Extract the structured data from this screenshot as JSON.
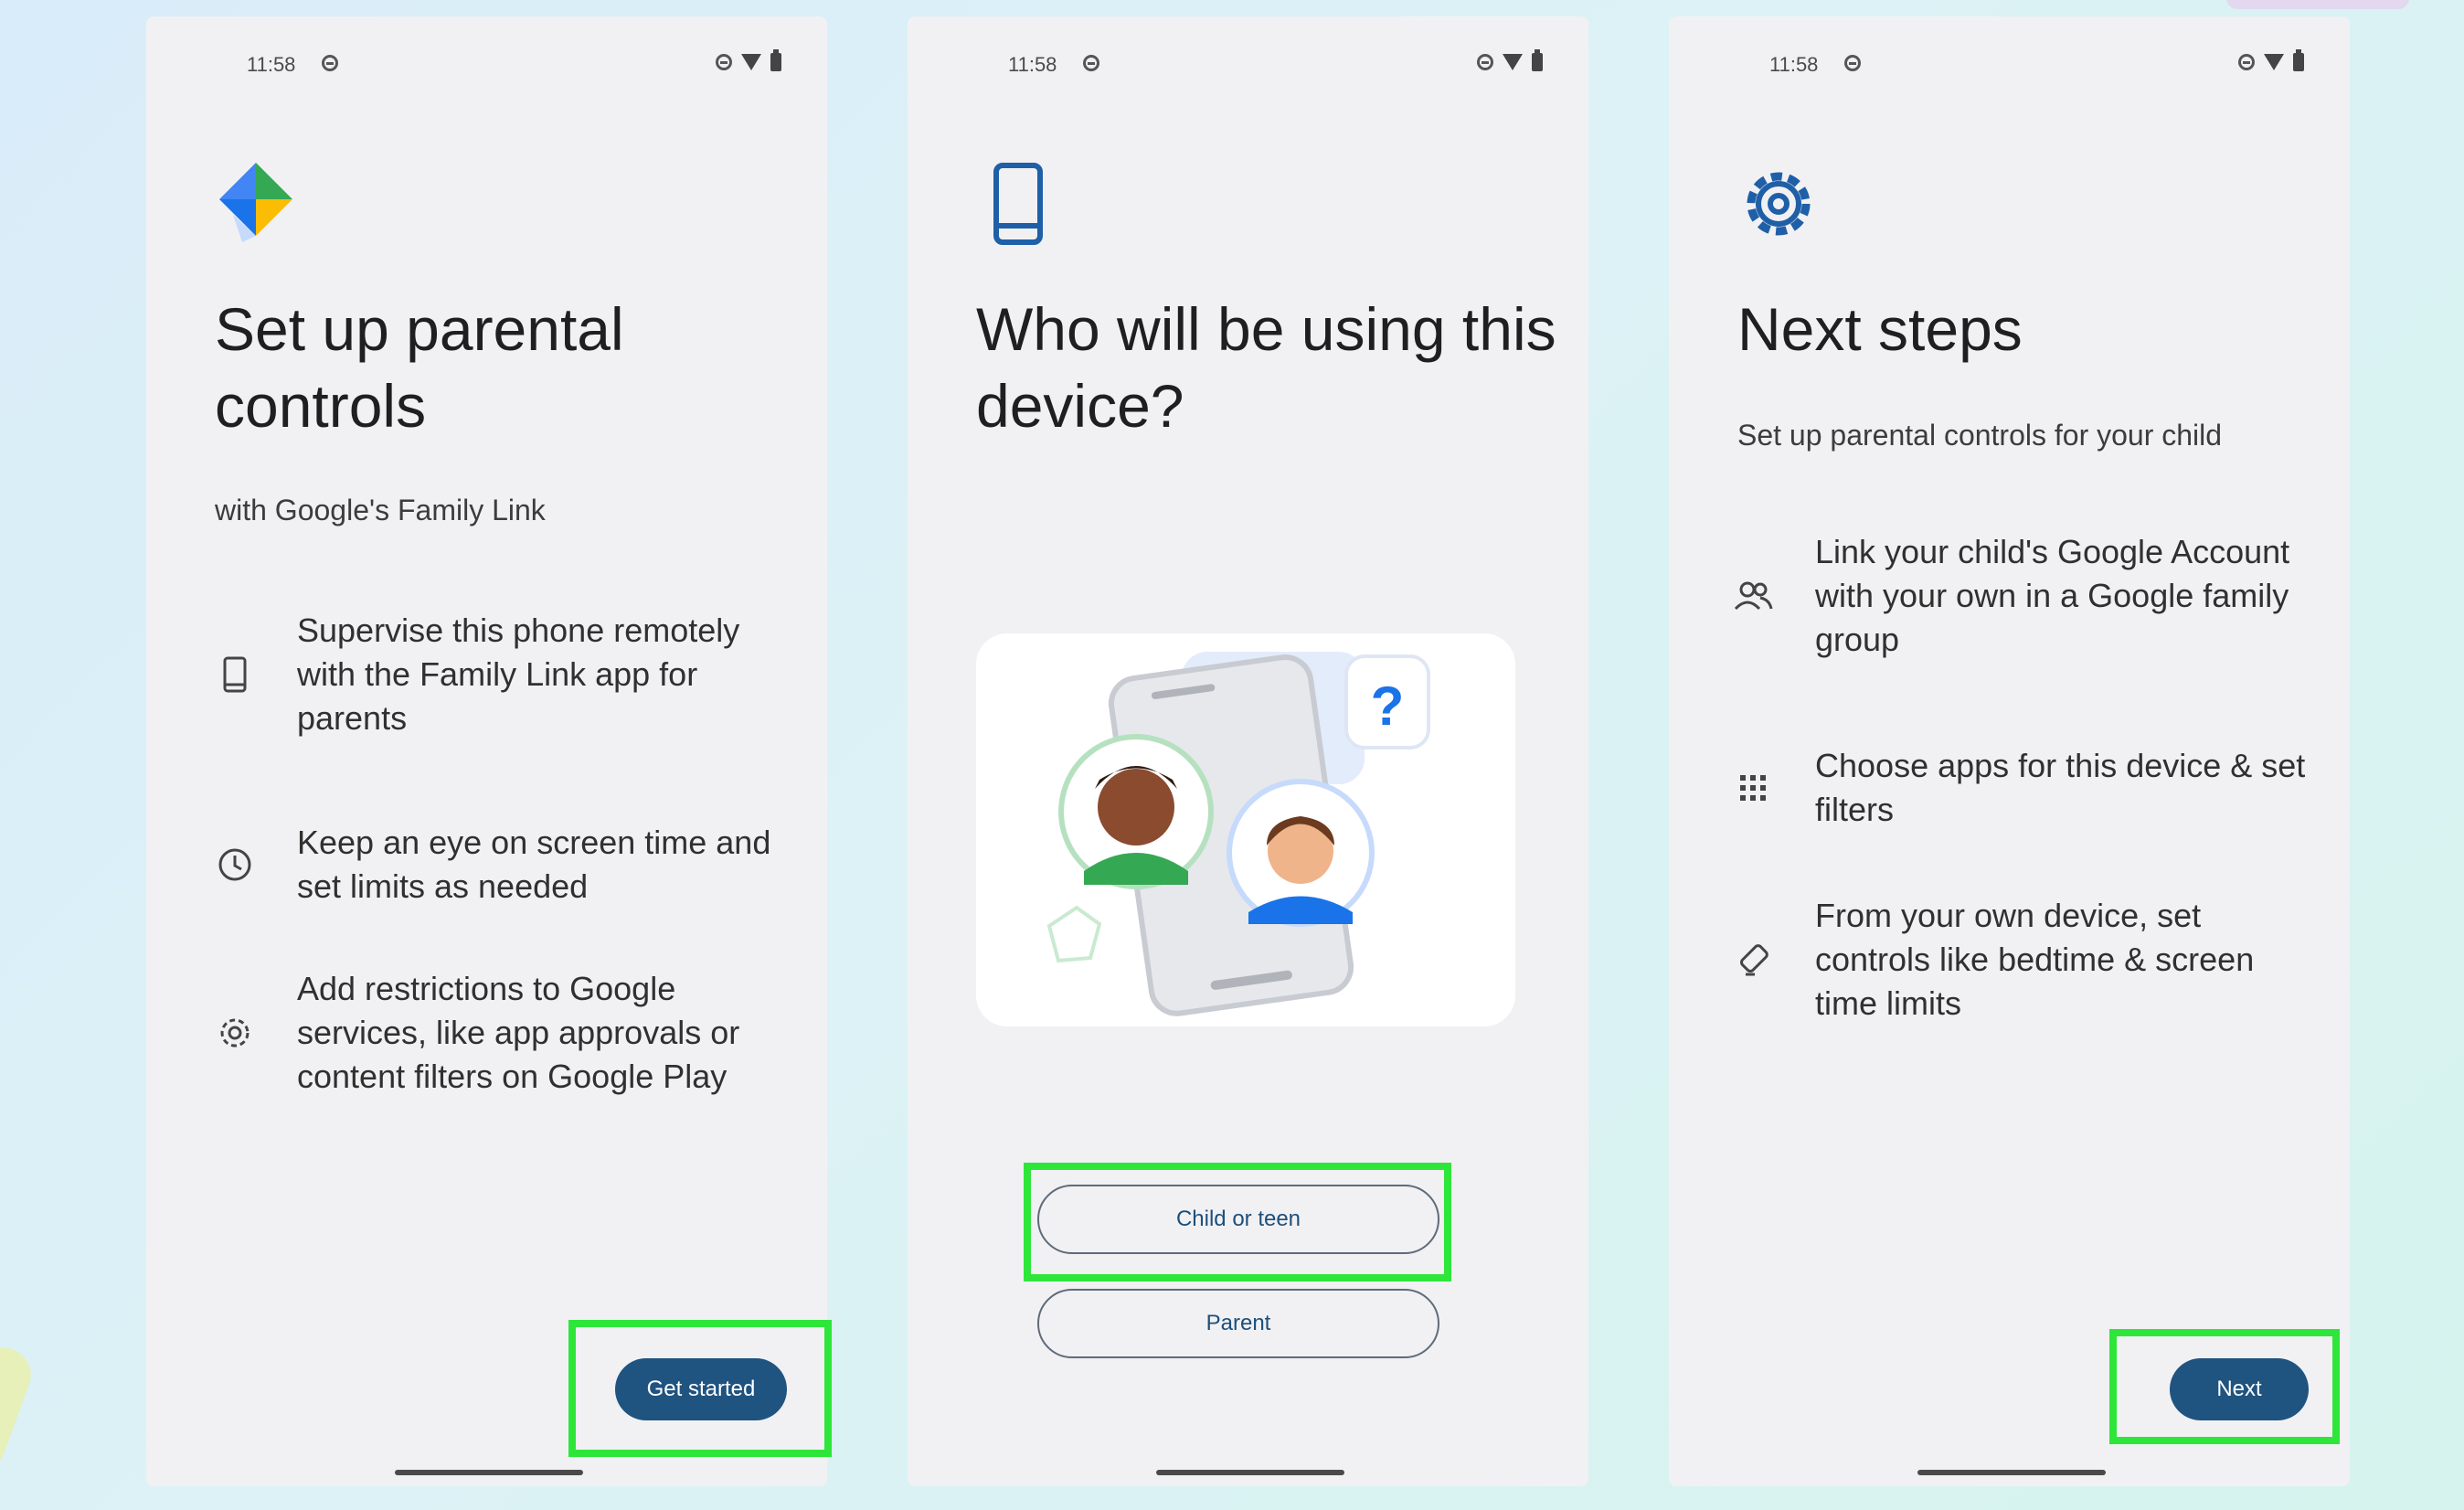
{
  "colors": {
    "primary_button": "#1f5380",
    "outline_button_text": "#1d4f7c",
    "highlight_box": "#2ee63a",
    "icon_blue": "#1f5fa8"
  },
  "screens": [
    {
      "status": {
        "time": "11:58"
      },
      "icon": "family-link-logo",
      "title": "Set up parental controls",
      "subtitle": "with Google's Family Link",
      "features": [
        {
          "icon": "phone-icon",
          "text": "Supervise this phone remotely with the Family Link app for parents"
        },
        {
          "icon": "clock-icon",
          "text": "Keep an eye on screen time and set limits as needed"
        },
        {
          "icon": "gear-icon",
          "text": "Add restrictions to Google services, like app approvals or content filters on Google Play"
        }
      ],
      "primary_button": "Get started"
    },
    {
      "status": {
        "time": "11:58"
      },
      "icon": "device-icon",
      "title": "Who will be using this device?",
      "illustration": {
        "question_mark": "?"
      },
      "options": [
        "Child or teen",
        "Parent"
      ]
    },
    {
      "status": {
        "time": "11:58"
      },
      "icon": "settings-gear-icon",
      "title": "Next steps",
      "subtitle": "Set up parental controls for your child",
      "features": [
        {
          "icon": "people-icon",
          "text": "Link your child's Google Account with your own in a Google family group"
        },
        {
          "icon": "apps-grid-icon",
          "text": "Choose apps for this device & set filters"
        },
        {
          "icon": "hourglass-icon",
          "text": "From your own device, set controls like bedtime & screen time limits"
        }
      ],
      "primary_button": "Next"
    }
  ]
}
